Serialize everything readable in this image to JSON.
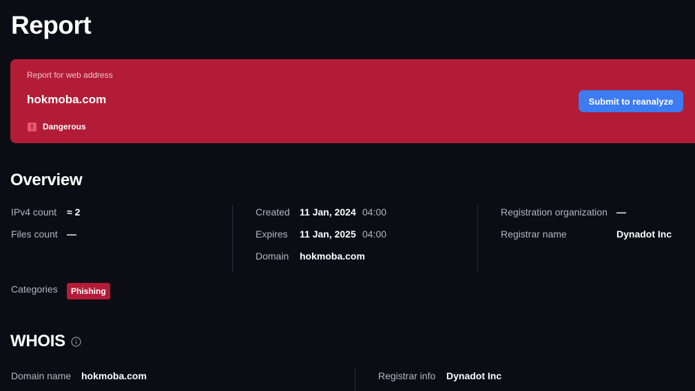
{
  "page": {
    "title": "Report"
  },
  "banner": {
    "caption": "Report for web address",
    "domain": "hokmoba.com",
    "verdict": "Dangerous",
    "verdict_icon": "danger-icon",
    "reanalyze_label": "Submit to reanalyze",
    "color": "#b31c37",
    "button_color": "#3d7bf0"
  },
  "overview": {
    "title": "Overview",
    "ipv4_label": "IPv4 count",
    "ipv4_value": "≈ 2",
    "files_label": "Files count",
    "files_value": "—",
    "created_label": "Created",
    "created_date": "11 Jan, 2024",
    "created_time": "04:00",
    "expires_label": "Expires",
    "expires_date": "11 Jan, 2025",
    "expires_time": "04:00",
    "domain_label": "Domain",
    "domain_value": "hokmoba.com",
    "reg_org_label": "Registration organization",
    "reg_org_value": "—",
    "registrar_label": "Registrar name",
    "registrar_value": "Dynadot Inc",
    "categories_label": "Categories",
    "categories": [
      "Phishing"
    ]
  },
  "whois": {
    "title": "WHOIS",
    "info_icon": "info-icon",
    "domain_name_label": "Domain name",
    "domain_name_value": "hokmoba.com",
    "registrar_info_label": "Registrar info",
    "registrar_info_value": "Dynadot Inc"
  }
}
